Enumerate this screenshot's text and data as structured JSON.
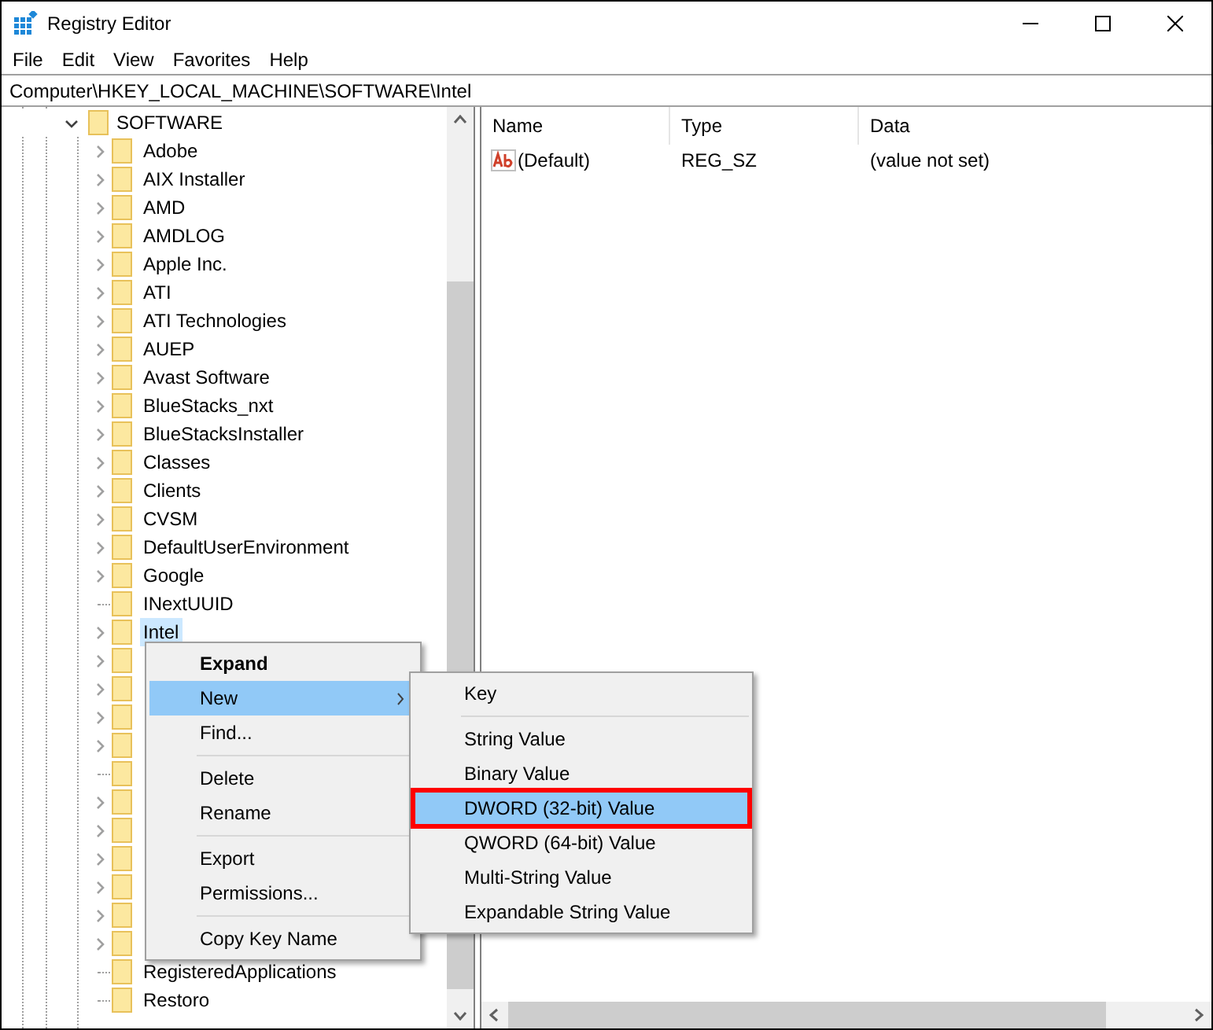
{
  "window": {
    "title": "Registry Editor"
  },
  "menu_bar": [
    "File",
    "Edit",
    "View",
    "Favorites",
    "Help"
  ],
  "address_bar": {
    "value": "Computer\\HKEY_LOCAL_MACHINE\\SOFTWARE\\Intel"
  },
  "tree": {
    "label": "SOFTWARE",
    "expanded": true,
    "children": [
      {
        "label": "Adobe",
        "expandable": true,
        "selected": false
      },
      {
        "label": "AIX Installer",
        "expandable": true,
        "selected": false
      },
      {
        "label": "AMD",
        "expandable": true,
        "selected": false
      },
      {
        "label": "AMDLOG",
        "expandable": true,
        "selected": false
      },
      {
        "label": "Apple Inc.",
        "expandable": true,
        "selected": false
      },
      {
        "label": "ATI",
        "expandable": true,
        "selected": false
      },
      {
        "label": "ATI Technologies",
        "expandable": true,
        "selected": false
      },
      {
        "label": "AUEP",
        "expandable": true,
        "selected": false
      },
      {
        "label": "Avast Software",
        "expandable": true,
        "selected": false
      },
      {
        "label": "BlueStacks_nxt",
        "expandable": true,
        "selected": false
      },
      {
        "label": "BlueStacksInstaller",
        "expandable": true,
        "selected": false
      },
      {
        "label": "Classes",
        "expandable": true,
        "selected": false
      },
      {
        "label": "Clients",
        "expandable": true,
        "selected": false
      },
      {
        "label": "CVSM",
        "expandable": true,
        "selected": false
      },
      {
        "label": "DefaultUserEnvironment",
        "expandable": true,
        "selected": false
      },
      {
        "label": "Google",
        "expandable": true,
        "selected": false
      },
      {
        "label": "INextUUID",
        "expandable": false,
        "selected": false
      },
      {
        "label": "Intel",
        "expandable": true,
        "selected": true
      },
      {
        "expandable": true,
        "selected": false
      },
      {
        "expandable": true,
        "selected": false
      },
      {
        "expandable": true,
        "selected": false
      },
      {
        "expandable": true,
        "selected": false
      },
      {
        "expandable": false,
        "selected": false
      },
      {
        "expandable": true,
        "selected": false
      },
      {
        "expandable": true,
        "selected": false
      },
      {
        "expandable": true,
        "selected": false
      },
      {
        "expandable": true,
        "selected": false
      },
      {
        "expandable": true,
        "selected": false
      },
      {
        "expandable": true,
        "selected": false
      },
      {
        "label": "RegisteredApplications",
        "expandable": false,
        "selected": false
      },
      {
        "label": "Restoro",
        "expandable": false,
        "selected": false
      }
    ]
  },
  "values_table": {
    "columns": [
      "Name",
      "Type",
      "Data"
    ],
    "rows": [
      {
        "name": "(Default)",
        "type": "REG_SZ",
        "data": "(value not set)"
      }
    ]
  },
  "context_menu": [
    {
      "kind": "item",
      "label": "Expand",
      "bold": true,
      "selected": false
    },
    {
      "kind": "submenu",
      "label": "New",
      "bold": false,
      "selected": true
    },
    {
      "kind": "item",
      "label": "Find...",
      "bold": false,
      "selected": false
    },
    {
      "kind": "separator"
    },
    {
      "kind": "item",
      "label": "Delete",
      "bold": false,
      "selected": false
    },
    {
      "kind": "item",
      "label": "Rename",
      "bold": false,
      "selected": false
    },
    {
      "kind": "separator"
    },
    {
      "kind": "item",
      "label": "Export",
      "bold": false,
      "selected": false
    },
    {
      "kind": "item",
      "label": "Permissions...",
      "bold": false,
      "selected": false
    },
    {
      "kind": "separator"
    },
    {
      "kind": "item",
      "label": "Copy Key Name",
      "bold": false,
      "selected": false
    }
  ],
  "new_submenu": [
    {
      "kind": "item",
      "label": "Key",
      "selected": false,
      "outlined": false
    },
    {
      "kind": "separator"
    },
    {
      "kind": "item",
      "label": "String Value",
      "selected": false,
      "outlined": false
    },
    {
      "kind": "item",
      "label": "Binary Value",
      "selected": false,
      "outlined": false
    },
    {
      "kind": "item",
      "label": "DWORD (32-bit) Value",
      "selected": true,
      "outlined": true
    },
    {
      "kind": "item",
      "label": "QWORD (64-bit) Value",
      "selected": false,
      "outlined": false
    },
    {
      "kind": "item",
      "label": "Multi-String Value",
      "selected": false,
      "outlined": false
    },
    {
      "kind": "item",
      "label": "Expandable String Value",
      "selected": false,
      "outlined": false
    }
  ]
}
